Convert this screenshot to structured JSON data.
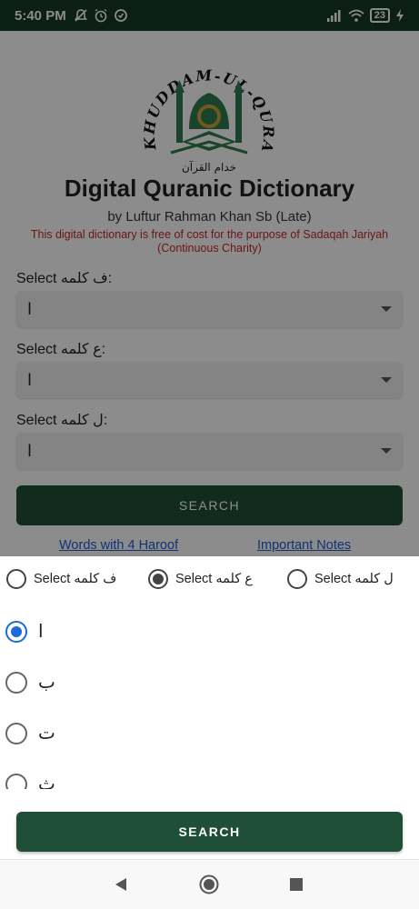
{
  "status_bar": {
    "time": "5:40 PM",
    "battery": "23",
    "icons": [
      "muted-notifications-icon",
      "alarm-icon",
      "data-saver-icon",
      "signal-icon",
      "wifi-icon",
      "battery-icon",
      "charging-icon"
    ]
  },
  "logo": {
    "arc_text": "KHUDDAM-UL-QURAN NZ",
    "urdu_text": "خدام القرآن"
  },
  "header": {
    "title": "Digital Quranic Dictionary",
    "subtitle": "by Luftur Rahman Khan Sb (Late)",
    "notice": "This digital dictionary is free of cost for the purpose of Sadaqah Jariyah (Continuous Charity)"
  },
  "form": {
    "fields": [
      {
        "label": "Select ف کلمه:",
        "value": "ا"
      },
      {
        "label": "Select ع کلمه:",
        "value": "ا"
      },
      {
        "label": "Select ل کلمه:",
        "value": "ا"
      }
    ],
    "search_label": "SEARCH",
    "link_words": "Words with 4 Haroof",
    "link_notes": "Important Notes"
  },
  "sheet": {
    "options": [
      {
        "label": "Select ف کلمه",
        "checked": false
      },
      {
        "label": "Select ع کلمه",
        "checked": true
      },
      {
        "label": "Select ل کلمه",
        "checked": false
      }
    ],
    "letters": [
      {
        "label": "ا",
        "checked": true
      },
      {
        "label": "ب",
        "checked": false
      },
      {
        "label": "ت",
        "checked": false
      },
      {
        "label": "ث",
        "checked": false
      }
    ],
    "search_label": "SEARCH"
  },
  "colors": {
    "primary_green": "#1f5037",
    "status_bar": "#173a26",
    "notice_red": "#c62828",
    "link_blue": "#1e5bd1",
    "radio_blue": "#1e6ad8"
  }
}
